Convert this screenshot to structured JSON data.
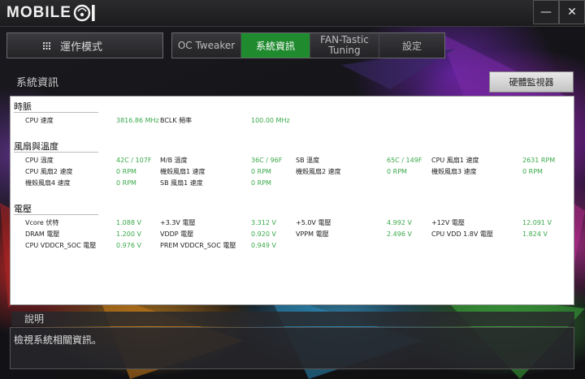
{
  "app": {
    "logo_text": "MOBILE",
    "logo_suffix_icon": "01-logo-icon"
  },
  "window": {
    "minimize_label": "—",
    "close_label": "✕"
  },
  "nav": {
    "mode_label": "運作模式",
    "tabs": [
      {
        "label": "OC Tweaker",
        "active": false
      },
      {
        "label": "系統資訊",
        "active": true
      },
      {
        "label": "FAN-Tastic\nTuning",
        "active": false
      },
      {
        "label": "設定",
        "active": false
      }
    ]
  },
  "section": {
    "title": "系統資訊",
    "hw_monitor_button": "硬體監視器"
  },
  "groups": {
    "clock": {
      "title": "時脈",
      "items": [
        {
          "label": "CPU 速度",
          "value": "3816.86 MHz"
        },
        {
          "label": "BCLK 頻率",
          "value": "100.00 MHz"
        }
      ]
    },
    "fan_temp": {
      "title": "風扇與溫度",
      "items": [
        {
          "label": "CPU 溫度",
          "value": "42C / 107F"
        },
        {
          "label": "M/B 溫度",
          "value": "36C / 96F"
        },
        {
          "label": "SB 溫度",
          "value": "65C / 149F"
        },
        {
          "label": "CPU 風扇1 速度",
          "value": "2631 RPM"
        },
        {
          "label": "CPU 風扇2 速度",
          "value": "0 RPM"
        },
        {
          "label": "機殼風扇1 速度",
          "value": "0 RPM"
        },
        {
          "label": "機殼風扇2 速度",
          "value": "0 RPM"
        },
        {
          "label": "機殼風扇3 速度",
          "value": "0 RPM"
        },
        {
          "label": "機殼風扇4 速度",
          "value": "0 RPM"
        },
        {
          "label": "SB 風扇1 速度",
          "value": "0 RPM"
        }
      ]
    },
    "voltage": {
      "title": "電壓",
      "items": [
        {
          "label": "Vcore 伏特",
          "value": "1.088 V"
        },
        {
          "label": "+3.3V 電壓",
          "value": "3.312 V"
        },
        {
          "label": "+5.0V 電壓",
          "value": "4.992 V"
        },
        {
          "label": "+12V 電壓",
          "value": "12.091 V"
        },
        {
          "label": "DRAM 電壓",
          "value": "1.200 V"
        },
        {
          "label": "VDDP 電壓",
          "value": "0.920 V"
        },
        {
          "label": "VPPM 電壓",
          "value": "2.496 V"
        },
        {
          "label": "CPU VDD 1.8V 電壓",
          "value": "1.824 V"
        },
        {
          "label": "CPU VDDCR_SOC 電壓",
          "value": "0.976 V"
        },
        {
          "label": "PREM VDDCR_SOC 電壓",
          "value": "0.949 V"
        }
      ]
    }
  },
  "description": {
    "title": "說明",
    "text": "檢視系統相關資訊。"
  },
  "colors": {
    "accent_tab": "#1f8a2e",
    "value_green": "#3aa84a"
  }
}
